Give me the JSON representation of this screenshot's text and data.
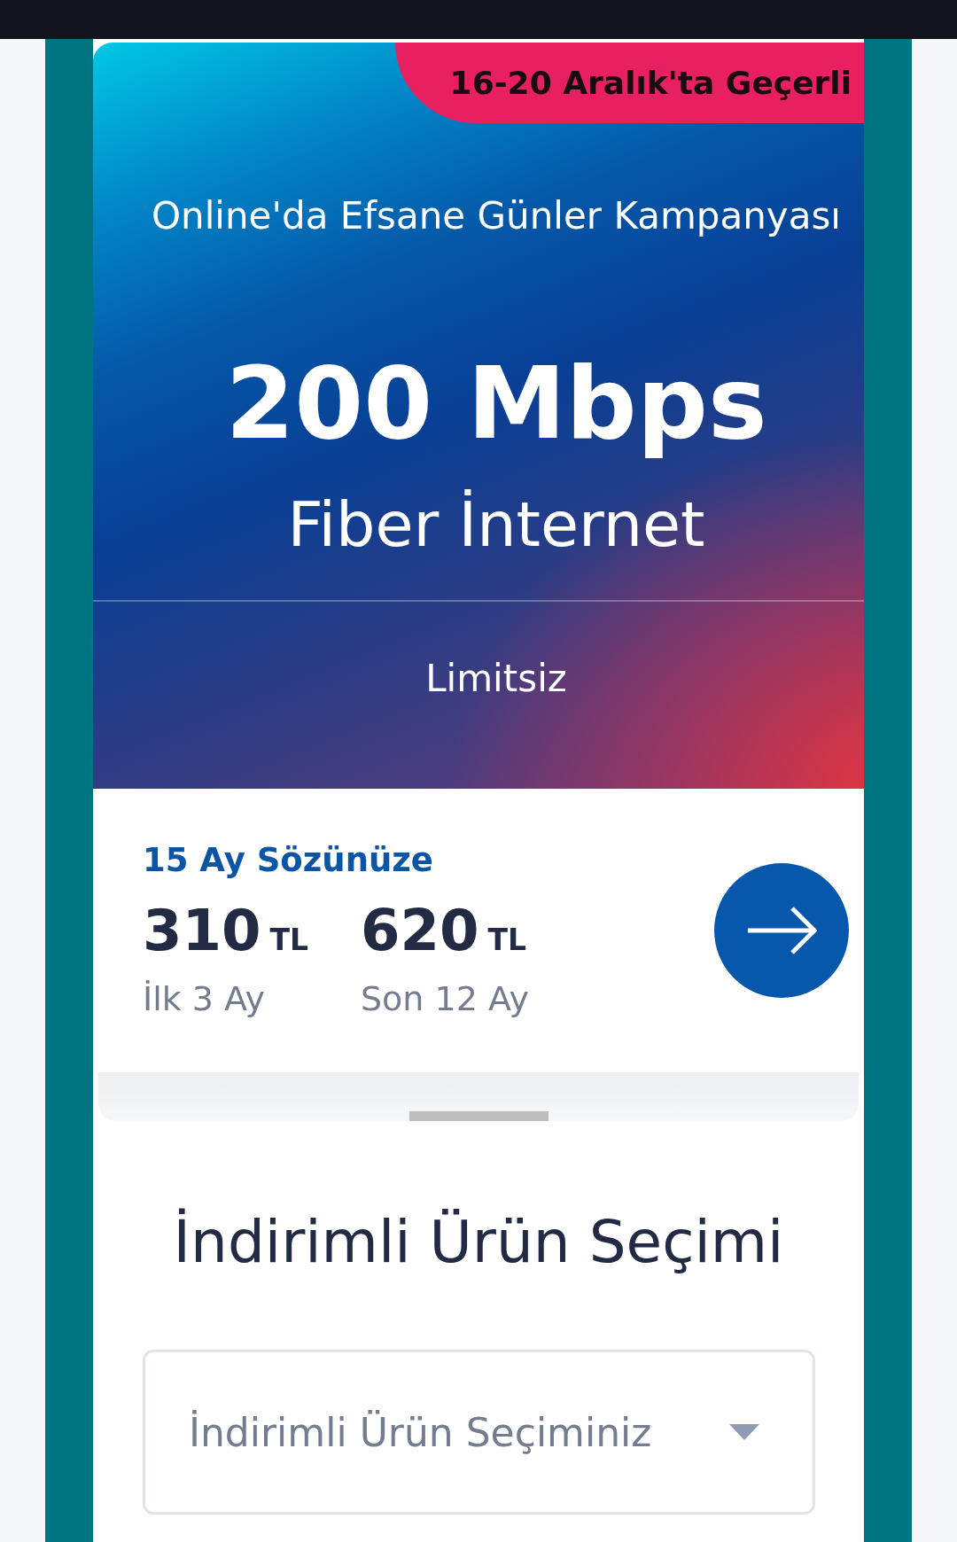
{
  "offer_card": {
    "badge": "16-20 Aralık'ta Geçerli",
    "campaign": "Online'da Efsane Günler Kampanyası",
    "speed": "200 Mbps",
    "product": "Fiber İnternet",
    "quota": "Limitsiz",
    "commitment": "15 Ay Sözünüze",
    "prices": [
      {
        "amount": "310",
        "currency": "TL",
        "period": "İlk 3 Ay"
      },
      {
        "amount": "620",
        "currency": "TL",
        "period": "Son 12 Ay"
      }
    ]
  },
  "discount_section": {
    "title": "İndirimli Ürün Seçimi",
    "dropdown": {
      "placeholder": "İndirimli Ürün Seçiminiz"
    }
  }
}
